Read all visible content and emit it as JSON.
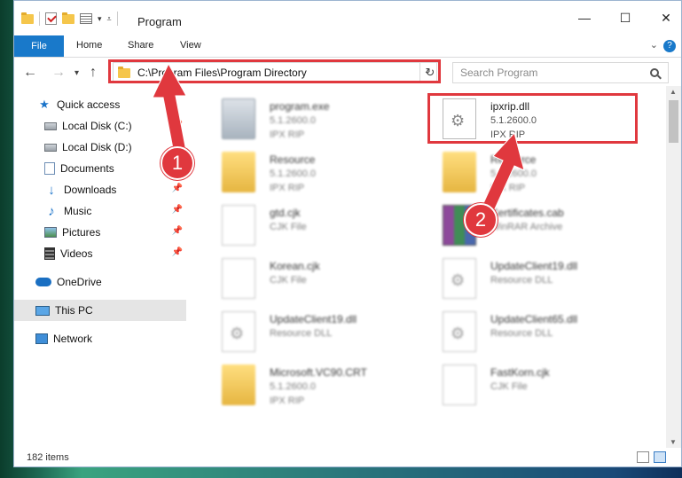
{
  "window": {
    "title": "Program"
  },
  "ribbon": {
    "tabs": [
      "File",
      "Home",
      "Share",
      "View"
    ]
  },
  "address": {
    "path": "C:\\Program Files\\Program Directory"
  },
  "search": {
    "placeholder": "Search Program"
  },
  "sidebar": {
    "items": [
      {
        "label": "Quick access",
        "icon": "star-icon",
        "pinned": false
      },
      {
        "label": "Local Disk (C:)",
        "icon": "drive-icon",
        "pinned": true
      },
      {
        "label": "Local Disk (D:)",
        "icon": "drive-icon",
        "pinned": false
      },
      {
        "label": "Documents",
        "icon": "documents-icon",
        "pinned": true
      },
      {
        "label": "Downloads",
        "icon": "download-icon",
        "pinned": true
      },
      {
        "label": "Music",
        "icon": "music-icon",
        "pinned": true
      },
      {
        "label": "Pictures",
        "icon": "pictures-icon",
        "pinned": true
      },
      {
        "label": "Videos",
        "icon": "videos-icon",
        "pinned": true
      },
      {
        "label": "OneDrive",
        "icon": "cloud-icon",
        "pinned": false
      },
      {
        "label": "This PC",
        "icon": "computer-icon",
        "pinned": false,
        "selected": true
      },
      {
        "label": "Network",
        "icon": "network-icon",
        "pinned": false
      }
    ]
  },
  "files": [
    {
      "name": "program.exe",
      "line2": "5.1.2600.0",
      "line3": "IPX RIP",
      "type": "exe"
    },
    {
      "name": "ipxrip.dll",
      "line2": "5.1.2600.0",
      "line3": "IPX RIP",
      "type": "dll",
      "highlighted": true
    },
    {
      "name": "Resource",
      "line2": "5.1.2600.0",
      "line3": "IPX RIP",
      "type": "folder"
    },
    {
      "name": "Resource",
      "line2": "5.1.2600.0",
      "line3": "IPX RIP",
      "type": "folder"
    },
    {
      "name": "gtd.cjk",
      "line2": "CJK File",
      "line3": "",
      "type": "page"
    },
    {
      "name": "Certificates.cab",
      "line2": "WinRAR Archive",
      "line3": "",
      "type": "cab"
    },
    {
      "name": "Korean.cjk",
      "line2": "CJK File",
      "line3": "",
      "type": "page"
    },
    {
      "name": "UpdateClient19.dll",
      "line2": "Resource DLL",
      "line3": "",
      "type": "dll"
    },
    {
      "name": "UpdateClient19.dll",
      "line2": "Resource DLL",
      "line3": "",
      "type": "dll"
    },
    {
      "name": "UpdateClient65.dll",
      "line2": "Resource DLL",
      "line3": "",
      "type": "dll"
    },
    {
      "name": "Microsoft.VC90.CRT",
      "line2": "5.1.2600.0",
      "line3": "IPX RIP",
      "type": "folder"
    },
    {
      "name": "FastKorn.cjk",
      "line2": "CJK File",
      "line3": "",
      "type": "page"
    }
  ],
  "status": {
    "item_count": "182 items"
  },
  "annotations": {
    "step1": "1",
    "step2": "2",
    "color": "#e0383e"
  }
}
